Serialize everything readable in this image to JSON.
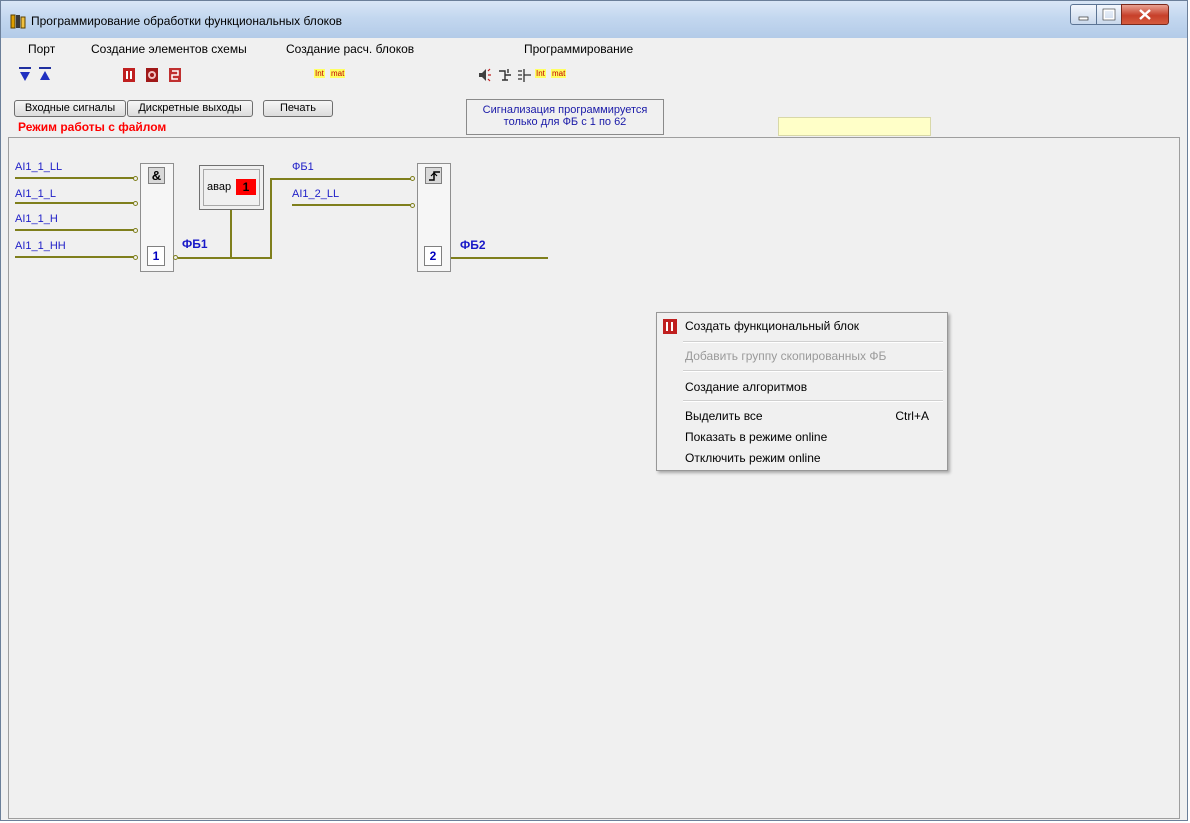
{
  "window": {
    "title": "Программирование обработки функциональных блоков"
  },
  "menu": [
    {
      "label": "Порт"
    },
    {
      "label": "Создание элементов схемы"
    },
    {
      "label": "Создание расч. блоков"
    },
    {
      "label": "Программирование"
    }
  ],
  "toolbar": {
    "int_label": "Int",
    "mat_label": "mat"
  },
  "buttons": {
    "input_signals": "Входные сигналы",
    "discrete_outputs": "Дискретные выходы",
    "print": "Печать"
  },
  "mode_label": "Режим работы с файлом",
  "signal_note": {
    "line1": "Сигнализация программируется",
    "line2": "только для ФБ с 1 по 62"
  },
  "diagram": {
    "block1": {
      "symbol": "&",
      "number": "1",
      "inputs": [
        "AI1_1_LL",
        "AI1_1_L",
        "AI1_1_H",
        "AI1_1_HH"
      ],
      "output": "ФБ1"
    },
    "alarm": {
      "label": "авар",
      "value": "1"
    },
    "block2": {
      "number": "2",
      "inputs": [
        "ФБ1",
        "AI1_2_LL"
      ],
      "output": "ФБ2"
    }
  },
  "context_menu": {
    "items": [
      {
        "label": "Создать функциональный блок",
        "enabled": true,
        "icon": "function-block-icon"
      },
      {
        "label": "Добавить группу скопированных ФБ",
        "enabled": false
      },
      {
        "label": "Создание алгоритмов",
        "enabled": true
      },
      {
        "label": "Выделить все",
        "shortcut": "Ctrl+A",
        "enabled": true
      },
      {
        "label": "Показать в режиме online",
        "enabled": true
      },
      {
        "label": "Отключить режим  online",
        "enabled": true
      }
    ]
  },
  "colors": {
    "wire": "#7f7f1c",
    "signal_text": "#2020c8",
    "alert_red": "#ff0000",
    "note_bg": "#ffffc8"
  }
}
